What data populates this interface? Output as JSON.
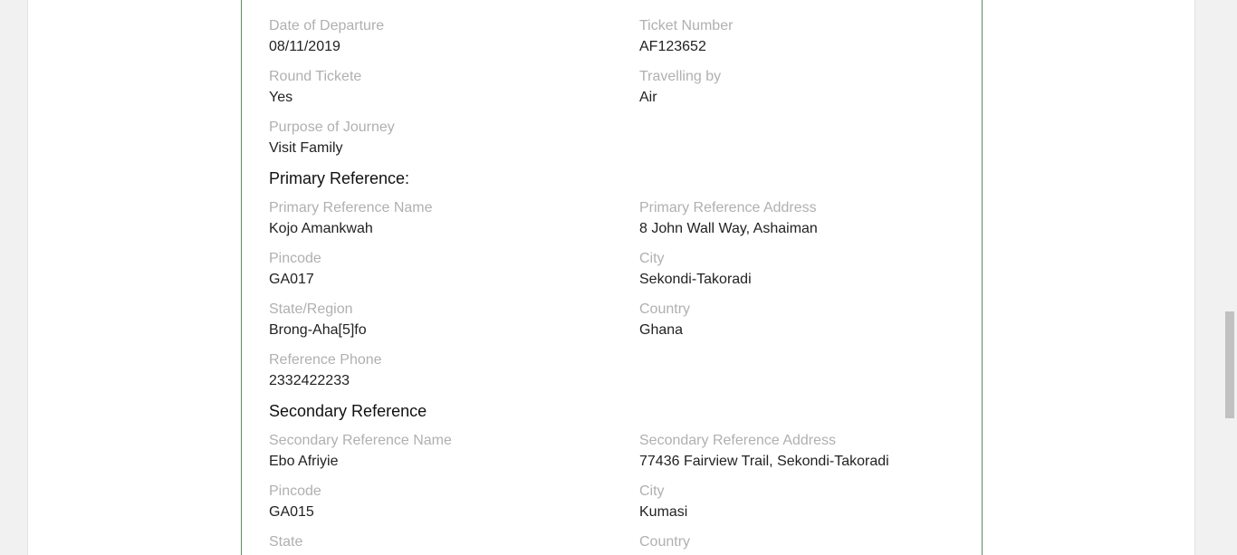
{
  "journey": {
    "departure_label": "Date of Departure",
    "departure_value": "08/11/2019",
    "ticket_label": "Ticket Number",
    "ticket_value": "AF123652",
    "round_label": "Round Tickete",
    "round_value": "Yes",
    "travel_label": "Travelling by",
    "travel_value": "Air",
    "purpose_label": "Purpose of Journey",
    "purpose_value": "Visit Family"
  },
  "primary": {
    "title": "Primary Reference:",
    "name_label": "Primary Reference Name",
    "name_value": "Kojo Amankwah",
    "address_label": "Primary Reference Address",
    "address_value": "8 John Wall Way, Ashaiman",
    "pincode_label": "Pincode",
    "pincode_value": "GA017",
    "city_label": "City",
    "city_value": "Sekondi-Takoradi",
    "state_label": "State/Region",
    "state_value": "Brong-Aha[5]fo",
    "country_label": "Country",
    "country_value": "Ghana",
    "phone_label": "Reference Phone",
    "phone_value": "2332422233"
  },
  "secondary": {
    "title": "Secondary Reference",
    "name_label": "Secondary Reference Name",
    "name_value": "Ebo Afriyie",
    "address_label": "Secondary Reference Address",
    "address_value": "77436 Fairview Trail, Sekondi-Takoradi",
    "pincode_label": "Pincode",
    "pincode_value": "GA015",
    "city_label": "City",
    "city_value": "Kumasi",
    "state_label": "State",
    "country_label": "Country"
  },
  "colors": {
    "label": "#b0b0b0",
    "value": "#222222",
    "card_border": "#5f8a5f"
  }
}
